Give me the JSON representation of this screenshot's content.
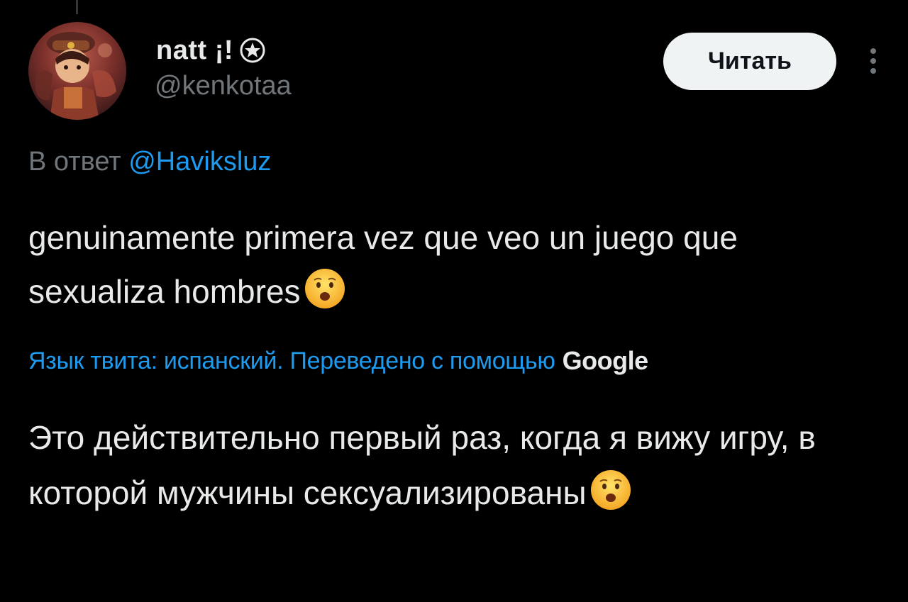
{
  "tweet": {
    "author": {
      "display_name": "natt ¡!",
      "handle": "@kenkotaa",
      "badge_icon": "star-badge-icon",
      "avatar_icon": "avatar-image"
    },
    "follow_button_label": "Читать",
    "more_icon": "more-vertical-icon",
    "reply_prefix": "В ответ",
    "reply_mention": "@Haviksluz",
    "text": "genuinamente primera vez que veo un juego que sexualiza hombres",
    "text_emoji": "astonished-face-emoji",
    "translation_label": "Язык твита: испанский. Переведено с помощью",
    "translation_provider": "Google",
    "translated_text": "Это действительно первый раз, когда я вижу игру, в которой мужчины сексуализированы",
    "translated_emoji": "astonished-face-emoji"
  },
  "colors": {
    "background": "#000000",
    "primary_text": "#e7e9ea",
    "secondary_text": "#71767b",
    "link": "#1d9bf0",
    "button_bg": "#eff3f4",
    "button_text": "#0f1419"
  }
}
